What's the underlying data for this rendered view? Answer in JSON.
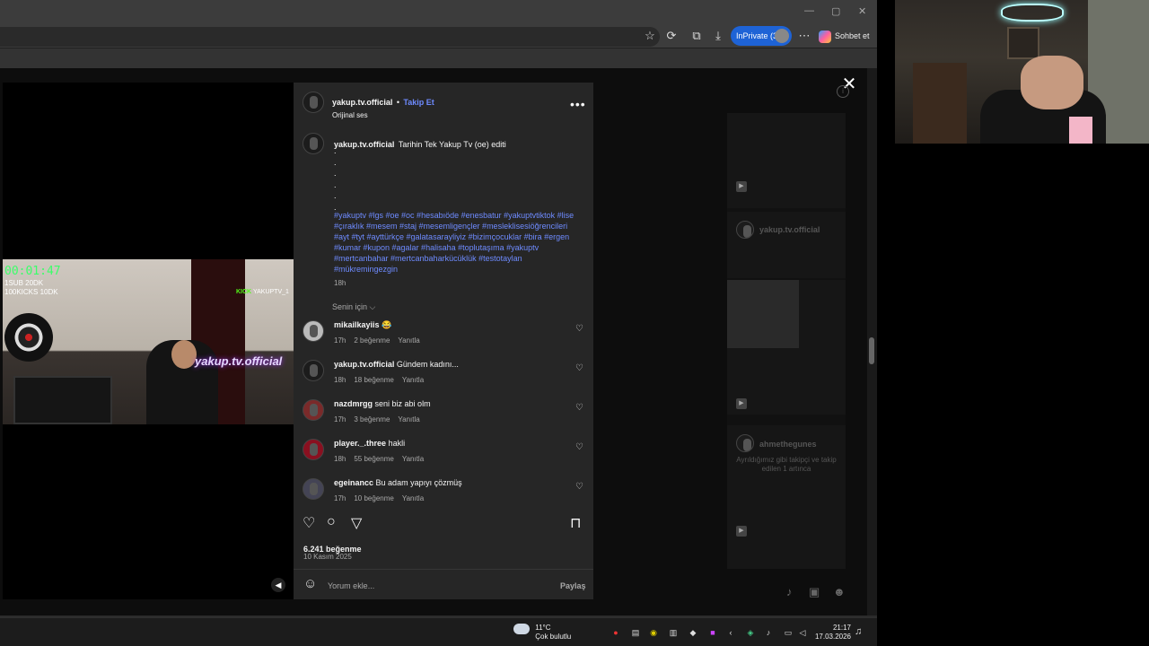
{
  "browser": {
    "inprivate_label": "InPrivate (3)",
    "copilot_label": "Sohbet et",
    "window_controls": [
      "—",
      "▢",
      "✕"
    ],
    "toolbar_icons": [
      "star-icon",
      "extensions-icon",
      "collections-icon",
      "download-icon",
      "more-icon"
    ]
  },
  "post": {
    "author": "yakup.tv.official",
    "separator": "•",
    "follow_label": "Takip Et",
    "audio": "Orijinal ses",
    "more": "•••",
    "caption_author": "yakup.tv.official",
    "caption_text": "Tarihin Tek Yakup Tv (oe) editi",
    "caption_dots": [
      ".",
      ".",
      ".",
      ".",
      ".",
      "."
    ],
    "hashtags": "#yakuptv #lgs #oe #oc #hesabıöde #enesbatur #yakuptvtiktok #lise #çıraklık #mesem #staj #mesemligençler #mesleklisesiöğrencileri #ayt #tyt #ayttürkçe #galatasarayliyiz #bizimçocuklar #bira #ergen #kumar #kupon #agalar #halisaha #toplutaşıma #yakuptv #mertcanbahar #mertcanbaharkücüklük #testotaylan #mükremingezgin",
    "caption_time": "18h",
    "sort_label": "Senin için ⌵",
    "likes": "6.241 beğenme",
    "date": "10 Kasım 2025",
    "comment_placeholder": "Yorum ekle...",
    "share_label": "Paylaş"
  },
  "comments": [
    {
      "user": "mikailkayiis",
      "text": "😂",
      "time": "17h",
      "likes": "2 beğenme",
      "reply": "Yanıtla"
    },
    {
      "user": "yakup.tv.official",
      "text": "Gündem kadını...",
      "time": "18h",
      "likes": "18 beğenme",
      "reply": "Yanıtla"
    },
    {
      "user": "nazdmrgg",
      "text": "seni biz abi olm",
      "time": "17h",
      "likes": "3 beğenme",
      "reply": "Yanıtla"
    },
    {
      "user": "player._.three",
      "text": "hakli",
      "time": "18h",
      "likes": "55 beğenme",
      "reply": "Yanıtla"
    },
    {
      "user": "egeinancc",
      "text": "Bu adam yapıyı çözmüş",
      "time": "17h",
      "likes": "10 beğenme",
      "reply": "Yanıtla"
    }
  ],
  "stream_overlay": {
    "timer": "00:01:47",
    "line1": "1SUB 20DK",
    "line2": "100KICKS 10DK",
    "kick_brand": "KICK",
    "kick_user": "YAKUPTV_1",
    "watermark": "yakup.tv.official"
  },
  "related": {
    "user1": "yakup.tv.official",
    "user2": "ahmethegunes",
    "text2": "Ayrıldığımız gibi takipçi ve takip edilen 1 artınca"
  },
  "taskbar": {
    "temp": "11°C",
    "weather": "Çok bulutlu",
    "time": "21:17",
    "date": "17.03.2026"
  },
  "colors": {
    "accent_blue": "#6e8bff",
    "inprivate": "#1e63d6",
    "timer_green": "#3cff6a",
    "panel_bg": "#262626"
  }
}
